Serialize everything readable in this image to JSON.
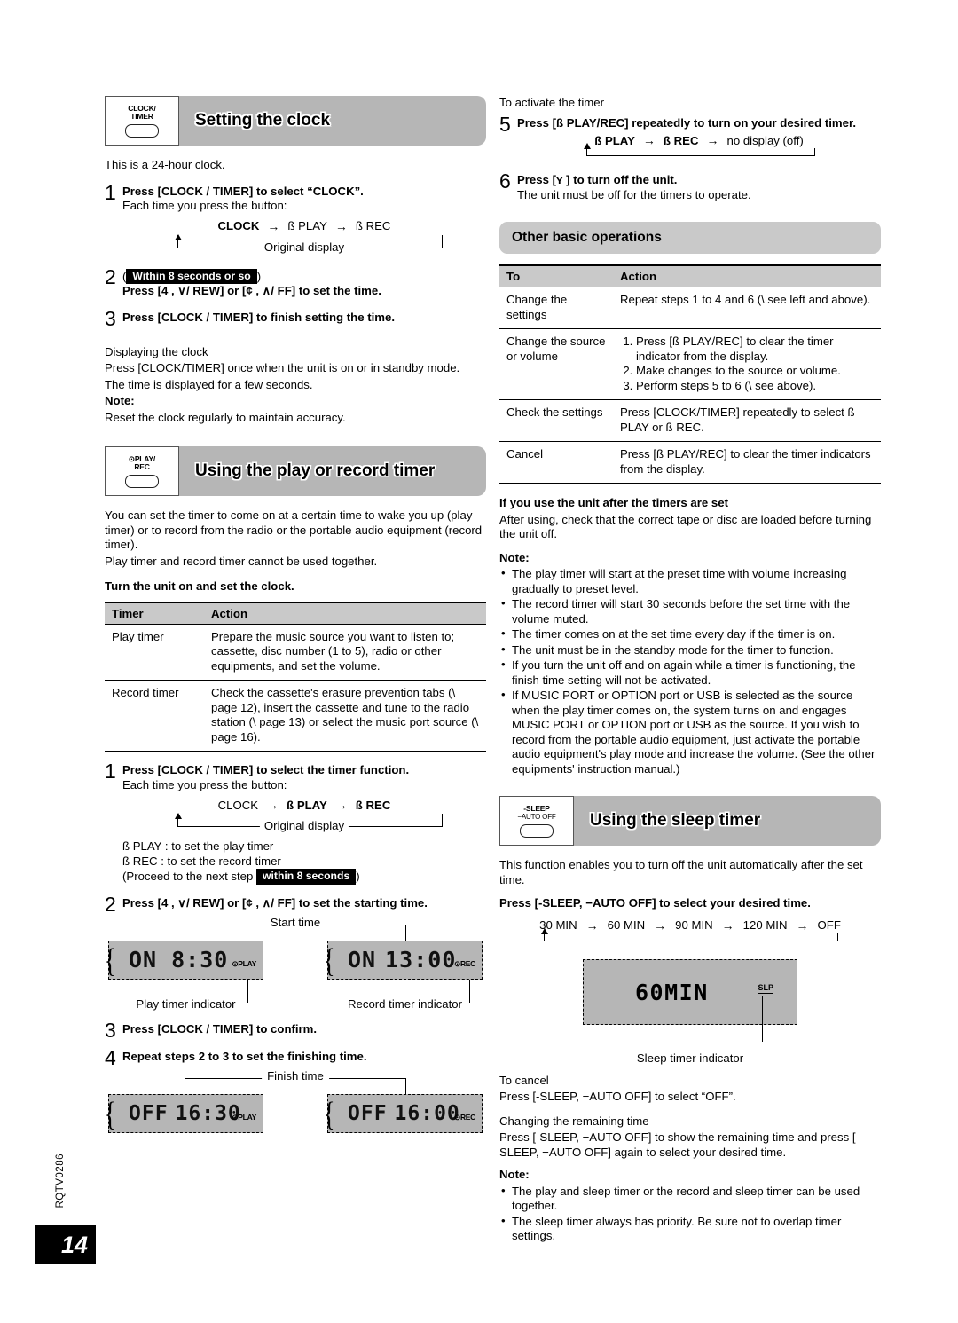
{
  "page": {
    "number": "14",
    "doc_code": "RQTV0286"
  },
  "left": {
    "section1": {
      "button_line1": "CLOCK/",
      "button_line2": "TIMER",
      "title": "Setting the clock",
      "intro": "This is a 24-hour clock.",
      "step1": {
        "num": "1",
        "head": "Press [CLOCK / TIMER] to select “CLOCK”.",
        "sub": "Each time you press the button:",
        "flow": [
          "CLOCK",
          "ß PLAY",
          "ß REC"
        ],
        "loop_label": "Original display"
      },
      "step2": {
        "num": "2",
        "badge": "Within 8 seconds or so",
        "paren_open": "(",
        "paren_close": ")",
        "head": "Press [4    , ∨/ REW] or [¢    , ∧/ FF] to set the time."
      },
      "step3": {
        "num": "3",
        "head": "Press [CLOCK / TIMER] to finish setting the time."
      },
      "display_clock_title": "Displaying the clock",
      "display_clock_body1": "Press [CLOCK/TIMER] once when the unit is on or in standby mode.",
      "display_clock_body2": "The time is displayed for a few seconds.",
      "note_label": "Note:",
      "note_body": "Reset the clock regularly to maintain accuracy."
    },
    "section2": {
      "button_line1": "⊙PLAY/",
      "button_line2": "REC",
      "title": "Using the play or record timer",
      "intro1": "You can set the timer to come on at a certain time to wake you up (play timer) or to record from the radio or the portable audio equipment (record timer).",
      "intro2": "Play timer and record timer cannot be used together.",
      "bold_line": "Turn the unit on and set the clock.",
      "table": {
        "headers": [
          "Timer",
          "Action"
        ],
        "rows": [
          {
            "key": "Play timer",
            "value": "Prepare the music source you want to listen to; cassette, disc number (1 to 5), radio or other equipments, and set the volume."
          },
          {
            "key": "Record timer",
            "value": "Check the cassette's erasure prevention tabs (\\    page 12), insert the cassette and tune to the radio station (\\    page 13) or select the music port source (\\    page 16)."
          }
        ]
      },
      "step1": {
        "num": "1",
        "head": "Press [CLOCK / TIMER] to select the timer function.",
        "sub": "Each time you press the button:",
        "flow": [
          "CLOCK",
          "ß PLAY",
          "ß REC"
        ],
        "loop_label": "Original display",
        "note_play": "ß PLAY : to set the play timer",
        "note_rec": "ß REC   : to set the record timer",
        "note_proceed_pre": "(Proceed to the next step",
        "note_proceed_badge": "within 8 seconds",
        "note_proceed_post": ")"
      },
      "step2": {
        "num": "2",
        "head": "Press [4    , ∨/ REW] or [¢    , ∧/ FF] to set the starting time.",
        "bracket_label": "Start time",
        "lcd_left": {
          "state": "ON",
          "time": "8:30",
          "tag": "⊙PLAY"
        },
        "lcd_right": {
          "state": "ON",
          "time": "13:00",
          "tag": "⊙REC"
        },
        "caption_left": "Play timer indicator",
        "caption_right": "Record timer indicator"
      },
      "step3": {
        "num": "3",
        "head": "Press [CLOCK / TIMER] to confirm."
      },
      "step4": {
        "num": "4",
        "head": "Repeat steps 2 to 3 to set the finishing time.",
        "bracket_label": "Finish time",
        "lcd_left": {
          "state": "OFF",
          "time": "16:30",
          "tag": "⊙PLAY"
        },
        "lcd_right": {
          "state": "OFF",
          "time": "16:00",
          "tag": "⊙REC"
        }
      }
    }
  },
  "right": {
    "activate": {
      "lead": "To activate the timer",
      "step5": {
        "num": "5",
        "head": "Press [ß PLAY/REC] repeatedly to turn on your desired timer.",
        "flow": [
          "ß PLAY",
          "ß REC",
          "no display (off)"
        ]
      },
      "step6": {
        "num": "6",
        "head": "Press [ʏ ] to turn off the unit.",
        "sub": "The unit must be off for the timers to operate."
      }
    },
    "other_ops": {
      "title": "Other basic operations",
      "table": {
        "headers": [
          "To",
          "Action"
        ],
        "rows": [
          {
            "key": "Change the settings",
            "value": "Repeat steps 1 to 4 and 6 (\\    see left and above)."
          },
          {
            "key": "Change the source or volume",
            "list": [
              "Press [ß PLAY/REC] to clear the timer indicator from the display.",
              "Make changes to the source or volume.",
              "Perform steps 5 to 6 (\\    see above)."
            ]
          },
          {
            "key": "Check the settings",
            "value": "Press [CLOCK/TIMER] repeatedly to select ß PLAY or ß REC."
          },
          {
            "key": "Cancel",
            "value": "Press [ß PLAY/REC] to clear the timer indicators from the display."
          }
        ]
      }
    },
    "after_set": {
      "title": "If you use the unit after the timers are set",
      "body": "After using, check that the correct tape or disc are loaded before turning the unit off.",
      "note_label": "Note:",
      "bullets": [
        "The play timer will start at the preset time with volume increasing gradually to preset level.",
        "The record timer will start 30 seconds before the set time with the volume muted.",
        "The timer comes on at the set time every day if the timer is on.",
        "The unit must be in the standby mode for the timer to function.",
        "If you turn the unit off and on again while a timer is functioning, the finish time setting will not be activated.",
        "If MUSIC PORT or OPTION port or USB is selected as the source when the play timer comes on, the system turns on and engages MUSIC PORT or OPTION port or USB as the source. If you wish to record from the portable audio equipment, just activate the portable audio equipment's play mode and increase the volume. (See the other equipments' instruction manual.)"
      ]
    },
    "sleep": {
      "button_line1": "-SLEEP",
      "button_line2": "−AUTO OFF",
      "title": "Using the sleep timer",
      "intro": "This function enables you to turn off the unit automatically after the set time.",
      "bold_line": "Press [-SLEEP, −AUTO OFF] to select your desired time.",
      "options": [
        "30 MIN",
        "60 MIN",
        "90 MIN",
        "120 MIN",
        "OFF"
      ],
      "lcd_value": "60MIN",
      "lcd_tag": "SLP",
      "lcd_caption": "Sleep timer indicator",
      "cancel_title": "To cancel",
      "cancel_body": "Press [-SLEEP, −AUTO OFF] to select “OFF”.",
      "change_title": "Changing the remaining time",
      "change_body": "Press [-SLEEP, −AUTO OFF] to show the remaining time and press [-SLEEP, −AUTO OFF] again to select your desired time.",
      "note_label": "Note:",
      "bullets": [
        "The play and sleep timer or the record and sleep timer can be used together.",
        "The sleep timer always has priority. Be sure not to overlap timer settings."
      ]
    }
  }
}
